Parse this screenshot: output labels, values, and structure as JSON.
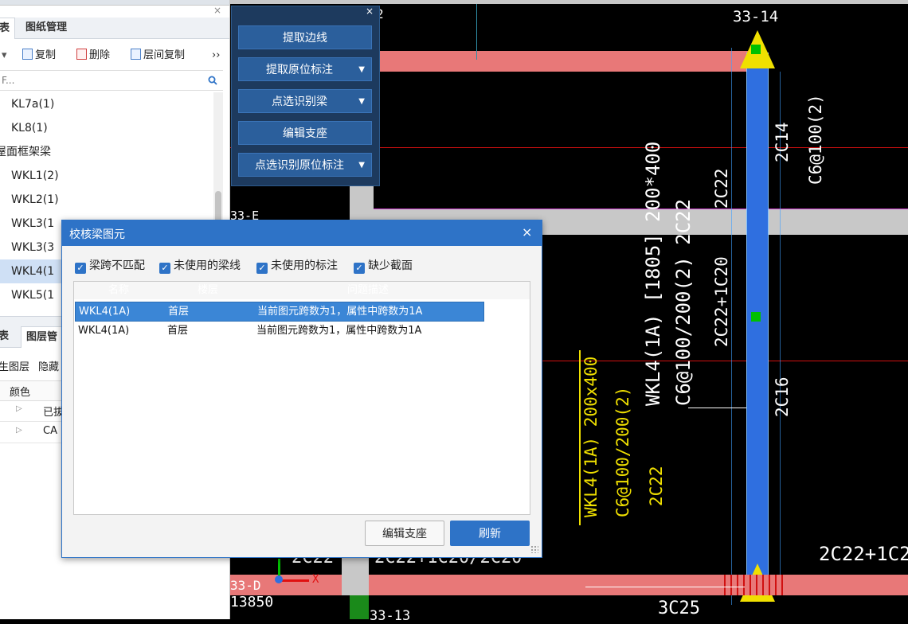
{
  "left_panel": {
    "close_glyph": "×",
    "tabs": [
      "表",
      "图纸管理"
    ],
    "toolbar": {
      "copy": "复制",
      "delete": "删除",
      "floor_copy": "层间复制",
      "more": "››",
      "dropdown": "▾"
    },
    "search_placeholder": "F...",
    "tree": [
      {
        "label": "KL7a(1)",
        "indent": 20
      },
      {
        "label": "KL8(1)",
        "indent": 20
      },
      {
        "label": "屋面框架梁",
        "indent": 0
      },
      {
        "label": "WKL1(2)",
        "indent": 20
      },
      {
        "label": "WKL2(1)",
        "indent": 20
      },
      {
        "label": "WKL3(1",
        "indent": 20
      },
      {
        "label": "WKL3(3",
        "indent": 20
      },
      {
        "label": "WKL4(1",
        "indent": 20
      },
      {
        "label": "WKL5(1",
        "indent": 20
      }
    ],
    "selected_index": 7,
    "lower_tabs": [
      "表",
      "图层管"
    ],
    "lower_toolbar": [
      "生图层",
      "隐藏"
    ],
    "layer_header": {
      "color": "颜色"
    },
    "layer_rows": [
      {
        "arrow": "▷",
        "label": "已拔"
      },
      {
        "arrow": "▷",
        "label": "CA"
      }
    ]
  },
  "beam_toolbar": {
    "close_glyph": "×",
    "buttons": [
      {
        "label": "提取边线",
        "has_caret": false
      },
      {
        "label": "提取原位标注",
        "has_caret": true
      },
      {
        "label": "点选识别梁",
        "has_caret": true
      },
      {
        "label": "编辑支座",
        "has_caret": false
      },
      {
        "label": "点选识别原位标注",
        "has_caret": true
      }
    ],
    "caret": "▼"
  },
  "dialog": {
    "title": "校核梁图元",
    "close_glyph": "×",
    "check_mark": "✓",
    "checkboxes": [
      "梁跨不匹配",
      "未使用的梁线",
      "未使用的标注",
      "缺少截面"
    ],
    "columns": [
      "名称",
      "楼层",
      "问题描述"
    ],
    "rows": [
      {
        "name": "WKL4(1A)",
        "floor": "首层",
        "desc": "当前图元跨数为1，属性中跨数为1A"
      },
      {
        "name": "WKL4(1A)",
        "floor": "首层",
        "desc": "当前图元跨数为1，属性中跨数为1A"
      }
    ],
    "selected_row": 0,
    "buttons": {
      "edit_support": "编辑支座",
      "refresh": "刷新"
    }
  },
  "canvas": {
    "labels": {
      "axis_top": "33-14",
      "axis_top_left": "2",
      "axis_left_mid": "33-E",
      "axis_bottom_left": "33-D",
      "axis_bottom_num": "13850",
      "axis_bottom": "33-13",
      "beam_main": "WKL4(1A) [1805] 200*400",
      "beam_stirrup": "C6@100/200(2) 2C22",
      "beam_yellow": "WKL4(1A) 200x400",
      "stirrup_yellow": "C6@100/200(2)",
      "bar_yellow": "2C22",
      "rebar_2c22": "2C22",
      "rebar_2c22_1c20": "2C22+1C20",
      "rebar_2c14": "2C14",
      "rebar_c6_100": "C6@100(2)",
      "rebar_2c16": "2C16",
      "rebar_bottom_right": "2C22+1C2",
      "rebar_bottom_left": "2C22",
      "rebar_bottom_mid": "2C22+1C20/2C20",
      "rebar_3c25": "3C25",
      "axis_x": "X"
    },
    "colors": {
      "beam_pink": "#e87878",
      "beam_blue": "#2f6fe0",
      "gray_band": "#c8c8c8",
      "yellow": "#f0e000",
      "green": "#00c000",
      "red_line": "#d01010",
      "magenta": "#d040d0"
    }
  }
}
